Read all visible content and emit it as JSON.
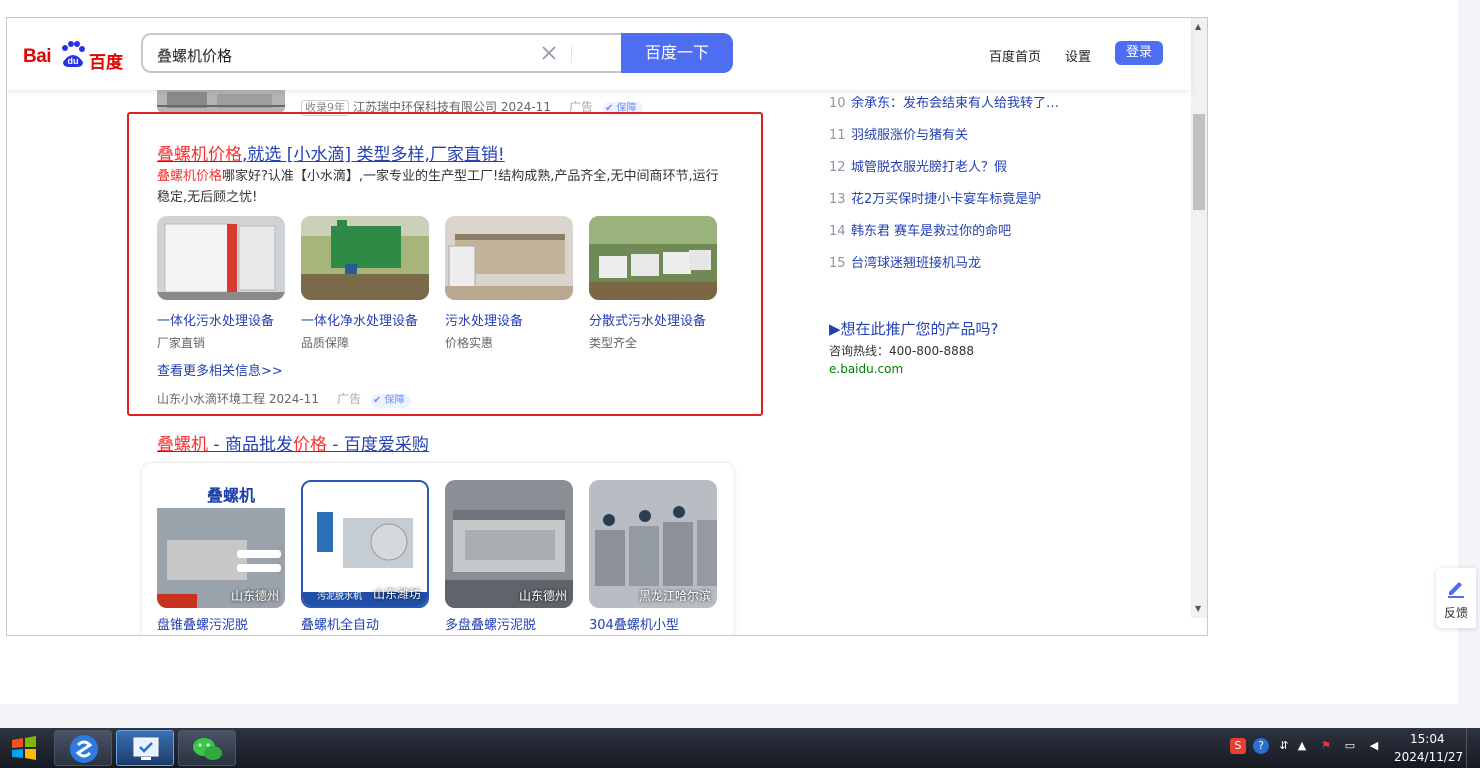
{
  "header": {
    "logo_bai": "Bai",
    "logo_du": "du",
    "logo_cn": "百度",
    "search_value": "叠螺机价格",
    "search_button": "百度一下",
    "nav_home": "百度首页",
    "nav_settings": "设置",
    "login": "登录"
  },
  "prev_result": {
    "tag": "收录9年",
    "company": "江苏瑞中环保科技有限公司 2024-11",
    "ad": "广告",
    "shield": "保障"
  },
  "ad_result": {
    "title_red": "叠螺机价格",
    "title_rest": ",就选 [小水滴] 类型多样,厂家直销!",
    "desc_red": "叠螺机价格",
    "desc_rest": "哪家好?认准【小水滴】,一家专业的生产型工厂!结构成熟,产品齐全,无中间商环节,运行稳定,无后顾之忧!",
    "items": [
      {
        "title": "一体化污水处理设备",
        "sub": "厂家直销"
      },
      {
        "title": "一体化净水处理设备",
        "sub": "品质保障"
      },
      {
        "title": "污水处理设备",
        "sub": "价格实惠"
      },
      {
        "title": "分散式污水处理设备",
        "sub": "类型齐全"
      }
    ],
    "more": "查看更多相关信息>>",
    "meta": "山东小水滴环境工程 2024-11",
    "ad": "广告",
    "shield": "保障"
  },
  "product_result": {
    "title_red1": "叠螺机",
    "title_mid": " - 商品批发",
    "title_red2": "价格",
    "title_rest": " - 百度爱采购",
    "products": [
      {
        "location": "山东德州",
        "overlay": "叠螺机",
        "caption": "盘锥叠螺污泥脱"
      },
      {
        "location": "山东潍坊",
        "overlay": "污泥脱水机",
        "caption": "叠螺机全自动"
      },
      {
        "location": "山东德州",
        "overlay": "",
        "caption": "多盘叠螺污泥脱"
      },
      {
        "location": "黑龙江哈尔滨",
        "overlay": "",
        "caption": "304叠螺机小型"
      }
    ]
  },
  "hot_list": [
    {
      "num": "10",
      "text": "余承东：发布会结束有人给我转了…"
    },
    {
      "num": "11",
      "text": "羽绒服涨价与猪有关"
    },
    {
      "num": "12",
      "text": "城管脱衣服光膀打老人？假"
    },
    {
      "num": "13",
      "text": "花2万买保时捷小卡宴车标竟是驴"
    },
    {
      "num": "14",
      "text": "韩东君 赛车是救过你的命吧"
    },
    {
      "num": "15",
      "text": "台湾球迷翘班接机马龙"
    }
  ],
  "promo": {
    "title": "▶想在此推广您的产品吗?",
    "phone": "咨询热线：400-800-8888",
    "link": "e.baidu.com"
  },
  "feedback": "反馈",
  "taskbar": {
    "time": "15:04",
    "date": "2024/11/27"
  },
  "colors": {
    "brand_blue": "#4e6ef2",
    "link_blue": "#2440b3",
    "highlight_red": "#f73131",
    "box_red": "#e02020"
  }
}
